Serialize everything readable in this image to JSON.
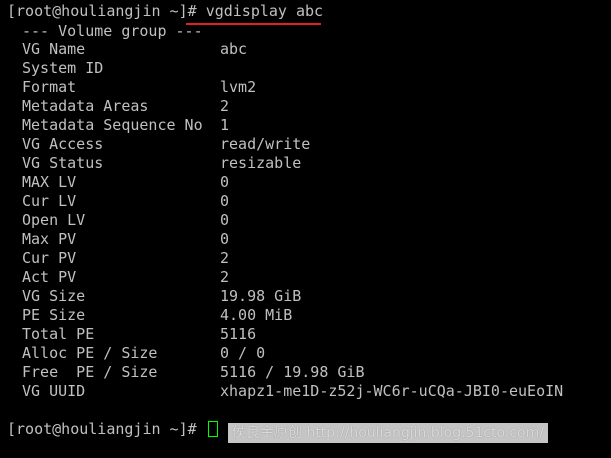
{
  "terminal": {
    "prompt1": "[root@houliangjin ~]#",
    "command": "vgdisplay abc",
    "section_header": "--- Volume group ---",
    "rows": [
      {
        "label": "VG Name",
        "value": "abc"
      },
      {
        "label": "System ID",
        "value": ""
      },
      {
        "label": "Format",
        "value": "lvm2"
      },
      {
        "label": "Metadata Areas",
        "value": "2"
      },
      {
        "label": "Metadata Sequence No",
        "value": "1"
      },
      {
        "label": "VG Access",
        "value": "read/write"
      },
      {
        "label": "VG Status",
        "value": "resizable"
      },
      {
        "label": "MAX LV",
        "value": "0"
      },
      {
        "label": "Cur LV",
        "value": "0"
      },
      {
        "label": "Open LV",
        "value": "0"
      },
      {
        "label": "Max PV",
        "value": "0"
      },
      {
        "label": "Cur PV",
        "value": "2"
      },
      {
        "label": "Act PV",
        "value": "2"
      },
      {
        "label": "VG Size",
        "value": "19.98 GiB"
      },
      {
        "label": "PE Size",
        "value": "4.00 MiB"
      },
      {
        "label": "Total PE",
        "value": "5116"
      },
      {
        "label": "Alloc PE / Size",
        "value": "0 / 0"
      },
      {
        "label": "Free  PE / Size",
        "value": "5116 / 19.98 GiB"
      },
      {
        "label": "VG UUID",
        "value": "xhapz1-me1D-z52j-WC6r-uCQa-JBI0-euEoIN"
      }
    ],
    "prompt2": "[root@houliangjin ~]#"
  },
  "watermark": {
    "text": "侯良金原创 http://houliangjin.blog.51cto.com/"
  },
  "colors": {
    "background": "#000000",
    "text": "#c0c0c0",
    "underline": "#e02020",
    "cursor": "#00ff00"
  }
}
